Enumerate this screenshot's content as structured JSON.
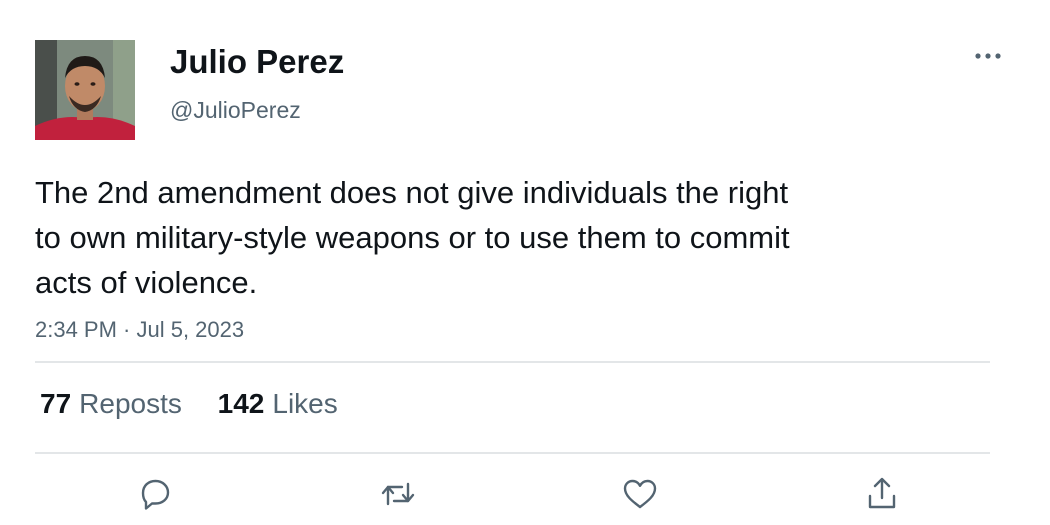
{
  "author": {
    "display_name": "Julio Perez",
    "handle": "@JulioPerez"
  },
  "post": {
    "text": "The 2nd amendment does not give individuals the right\nto own military-style weapons or to use them to commit\nacts of violence.",
    "timestamp": "2:34 PM · Jul 5, 2023"
  },
  "stats": {
    "reposts_count": "77",
    "reposts_label": "Reposts",
    "likes_count": "142",
    "likes_label": "Likes"
  },
  "icons": {
    "more": "more-horizontal-icon",
    "reply": "reply-icon",
    "repost": "repost-icon",
    "like": "heart-icon",
    "share": "share-icon"
  },
  "colors": {
    "text_primary": "#0f1419",
    "text_secondary": "#536471",
    "divider": "#e3e6e8"
  }
}
